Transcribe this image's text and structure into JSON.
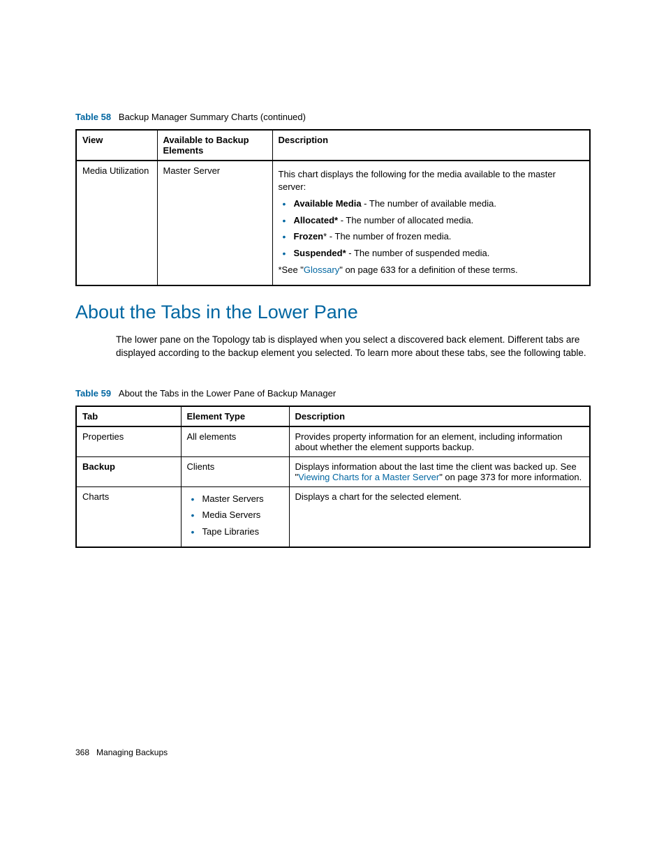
{
  "table58": {
    "caption_label": "Table 58",
    "caption_text": "Backup Manager Summary Charts (continued)",
    "headers": {
      "c1": "View",
      "c2": "Available to Backup Elements",
      "c3": "Description"
    },
    "row": {
      "view": "Media Utilization",
      "elements": "Master Server",
      "desc_intro": "This chart displays the following for the media available to the master server:",
      "items": [
        {
          "term": "Available Media",
          "text": " - The number of available media."
        },
        {
          "term": "Allocated*",
          "text": " - The number of allocated media."
        },
        {
          "term": "Frozen",
          "star": "*",
          "text": " - The number of frozen media."
        },
        {
          "term": "Suspended*",
          "text": " - The number of suspended media."
        }
      ],
      "footnote_pre": "*See \"",
      "footnote_link": "Glossary",
      "footnote_post": "\" on page 633 for a definition of these terms."
    }
  },
  "heading": "About the Tabs in the Lower Pane",
  "body": "The lower pane on the Topology tab is displayed when you select a discovered back element. Different tabs are displayed according to the backup element you selected. To learn more about these tabs, see the following table.",
  "table59": {
    "caption_label": "Table 59",
    "caption_text": "About the Tabs in the Lower Pane of Backup Manager",
    "headers": {
      "c1": "Tab",
      "c2": "Element Type",
      "c3": "Description"
    },
    "rows": [
      {
        "tab": "Properties",
        "type_text": "All elements",
        "desc": "Provides property information for an element, including information about whether the element supports backup."
      },
      {
        "tab": "Backup",
        "tab_bold": true,
        "type_text": "Clients",
        "desc_pre": "Displays information about the last time the client was backed up. See \"",
        "desc_link": "Viewing Charts for a Master Server",
        "desc_post": "\" on page 373 for more information."
      },
      {
        "tab": "Charts",
        "type_list": [
          "Master Servers",
          "Media Servers",
          "Tape Libraries"
        ],
        "desc": "Displays a chart for the selected element."
      }
    ]
  },
  "footer": {
    "page": "368",
    "section": "Managing Backups"
  }
}
